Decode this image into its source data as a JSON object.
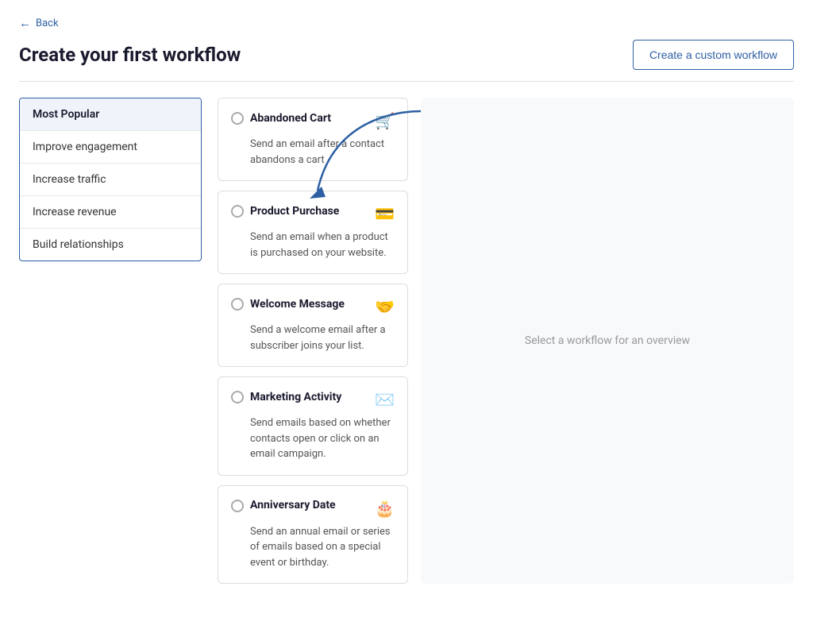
{
  "back": {
    "label": "Back"
  },
  "page": {
    "title": "Create your first workflow"
  },
  "create_custom_btn": "Create a custom workflow",
  "sidebar": {
    "items": [
      {
        "id": "most-popular",
        "label": "Most Popular",
        "active": true
      },
      {
        "id": "improve-engagement",
        "label": "Improve engagement",
        "active": false
      },
      {
        "id": "increase-traffic",
        "label": "Increase traffic",
        "active": false
      },
      {
        "id": "increase-revenue",
        "label": "Increase revenue",
        "active": false
      },
      {
        "id": "build-relationships",
        "label": "Build relationships",
        "active": false
      }
    ]
  },
  "workflows": [
    {
      "id": "abandoned-cart",
      "title": "Abandoned Cart",
      "description": "Send an email after a contact abandons a cart",
      "icon": "🛒"
    },
    {
      "id": "product-purchase",
      "title": "Product Purchase",
      "description": "Send an email when a product is purchased on your website.",
      "icon": "💳"
    },
    {
      "id": "welcome-message",
      "title": "Welcome Message",
      "description": "Send a welcome email after a subscriber joins your list.",
      "icon": "🤝"
    },
    {
      "id": "marketing-activity",
      "title": "Marketing Activity",
      "description": "Send emails based on whether contacts open or click on an email campaign.",
      "icon": "✉️"
    },
    {
      "id": "anniversary-date",
      "title": "Anniversary Date",
      "description": "Send an annual email or series of emails based on a special event or birthday.",
      "icon": "🎂"
    }
  ],
  "preview": {
    "placeholder": "Select a workflow for an overview"
  }
}
